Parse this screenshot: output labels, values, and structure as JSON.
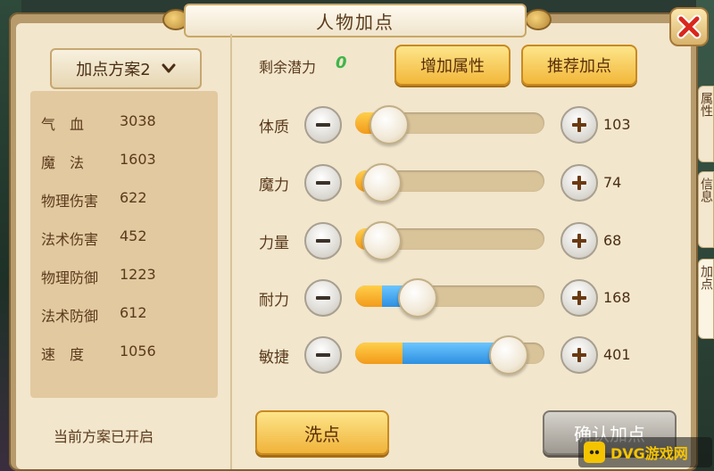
{
  "title": "人物加点",
  "plan_selector": {
    "label": "加点方案2"
  },
  "stats": [
    {
      "name": "气　血",
      "value": "3038"
    },
    {
      "name": "魔　法",
      "value": "1603"
    },
    {
      "name": "物理伤害",
      "value": "622"
    },
    {
      "name": "法术伤害",
      "value": "452"
    },
    {
      "name": "物理防御",
      "value": "1223"
    },
    {
      "name": "法术防御",
      "value": "612"
    },
    {
      "name": "速　度",
      "value": "1056"
    }
  ],
  "plan_status": "当前方案已开启",
  "potential": {
    "label": "剩余潜力",
    "value": "0"
  },
  "buttons": {
    "add_attributes": "增加属性",
    "recommend": "推荐加点",
    "reset": "洗点",
    "confirm": "确认加点"
  },
  "attributes": [
    {
      "name": "体质",
      "value": "103",
      "orange_fraction": 0.17,
      "blue_fraction": 0.0,
      "knob_fraction": 0.17
    },
    {
      "name": "魔力",
      "value": "74",
      "orange_fraction": 0.13,
      "blue_fraction": 0.0,
      "knob_fraction": 0.13
    },
    {
      "name": "力量",
      "value": "68",
      "orange_fraction": 0.13,
      "blue_fraction": 0.0,
      "knob_fraction": 0.13
    },
    {
      "name": "耐力",
      "value": "168",
      "orange_fraction": 0.14,
      "blue_fraction": 0.12,
      "knob_fraction": 0.32
    },
    {
      "name": "敏捷",
      "value": "401",
      "orange_fraction": 0.25,
      "blue_fraction": 0.52,
      "knob_fraction": 0.8
    }
  ],
  "side_tabs": [
    "属性",
    "信息",
    "加点"
  ],
  "watermark": "DVG游戏网",
  "colors": {
    "potential_value": "#3fb54a",
    "bar_orange": "#f29a1a",
    "bar_blue": "#2d8fe0",
    "close_red": "#d9261c"
  },
  "icons": {
    "close": "close-x-icon",
    "dropdown": "chevron-down-icon",
    "minus": "minus-icon",
    "plus": "plus-icon"
  }
}
